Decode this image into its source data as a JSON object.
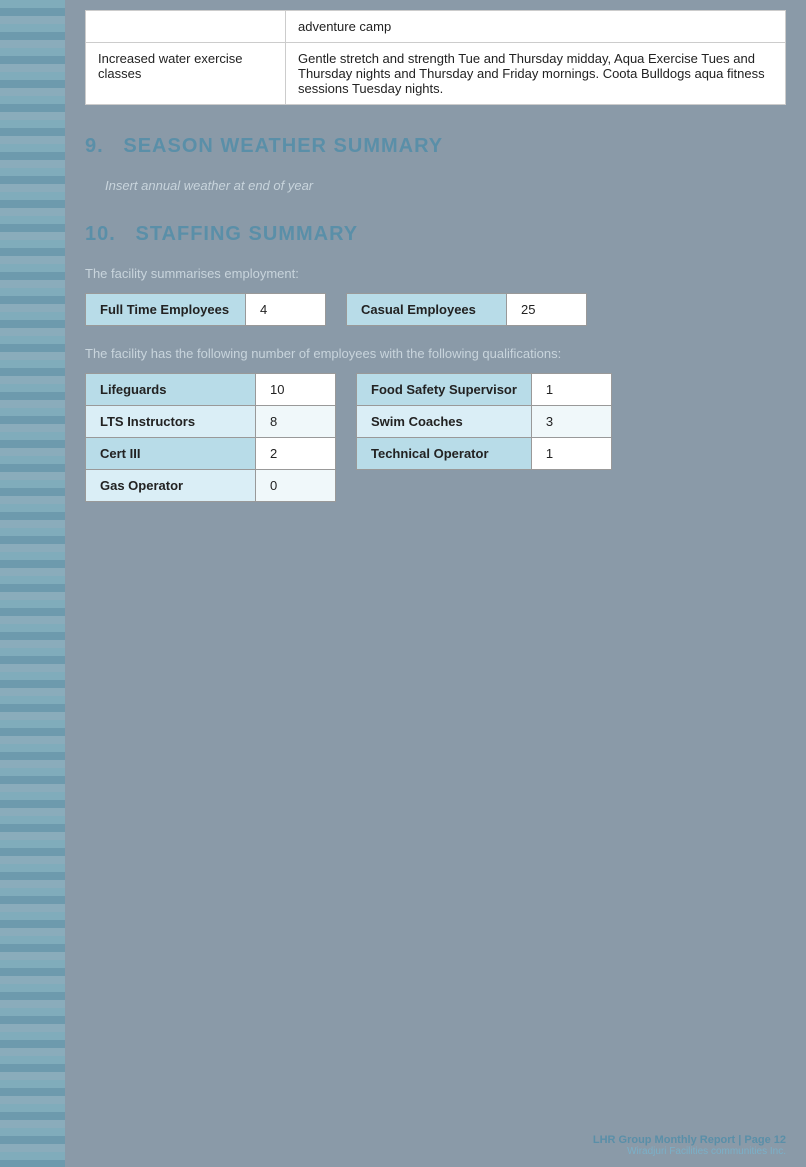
{
  "page": {
    "background_color": "#8a9aa8"
  },
  "top_table": {
    "row1": {
      "col1": "",
      "col2": "adventure camp"
    },
    "row2": {
      "col1": "Increased water exercise classes",
      "col2": "Gentle stretch and strength Tue and Thursday midday, Aqua Exercise Tues and Thursday nights and Thursday and Friday mornings. Coota Bulldogs aqua fitness sessions Tuesday nights."
    }
  },
  "section9": {
    "number": "9.",
    "title": "SEASON WEATHER SUMMARY",
    "placeholder": "Insert annual weather at end of year"
  },
  "section10": {
    "number": "10.",
    "title": "STAFFING SUMMARY",
    "intro": "The facility summarises employment:",
    "employment": [
      {
        "label": "Full Time Employees",
        "value": "4"
      },
      {
        "label": "Casual Employees",
        "value": "25"
      }
    ],
    "qual_note": "The facility has the following number of employees with the following qualifications:",
    "qualifications_left": [
      {
        "label": "Lifeguards",
        "value": "10"
      },
      {
        "label": "LTS Instructors",
        "value": "8"
      },
      {
        "label": "Cert III",
        "value": "2"
      },
      {
        "label": "Gas Operator",
        "value": "0"
      }
    ],
    "qualifications_right": [
      {
        "label": "Food Safety Supervisor",
        "value": "1"
      },
      {
        "label": "Swim Coaches",
        "value": "3"
      },
      {
        "label": "Technical Operator",
        "value": "1"
      }
    ]
  },
  "footer": {
    "line1": "LHR Group Monthly Report | Page 12",
    "line2": "Wiradjuri Facilities communities Inc."
  }
}
